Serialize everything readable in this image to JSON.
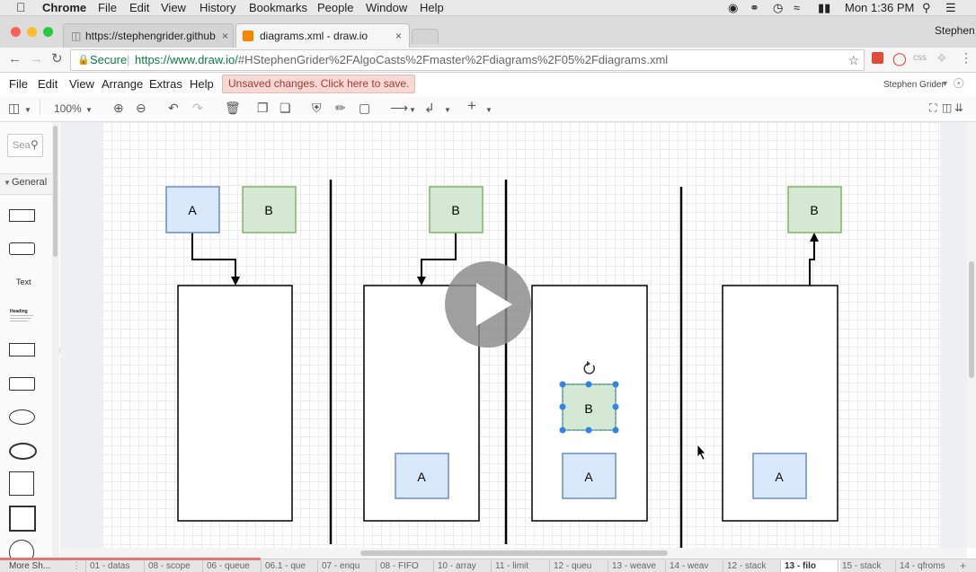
{
  "menubar": {
    "app_name": "Chrome",
    "items": [
      "File",
      "Edit",
      "View",
      "History",
      "Bookmarks",
      "People",
      "Window",
      "Help"
    ],
    "clock": "Mon 1:36 PM"
  },
  "browser": {
    "profile": "Stephen",
    "tabs": [
      {
        "title": "https://stephengrider.github.io"
      },
      {
        "title": "diagrams.xml - draw.io"
      }
    ],
    "secure_label": "Secure",
    "url_host": "https://www.draw.io/",
    "url_rest": "#HStephenGrider%2FAlgoCasts%2Fmaster%2Fdiagrams%2F05%2Fdiagrams.xml",
    "ext_css": "css"
  },
  "drawio": {
    "menu": [
      "File",
      "Edit",
      "View",
      "Arrange",
      "Extras",
      "Help"
    ],
    "unsaved_notice": "Unsaved changes. Click here to save.",
    "user": "Stephen Grider",
    "zoom": "100%",
    "search_placeholder": "Sea",
    "sidebar_section": "General",
    "text_shape_label": "Text",
    "heading_shape_label": "Heading"
  },
  "diagram": {
    "labels": {
      "a": "A",
      "b": "B"
    }
  },
  "bottom": {
    "more_shapes": "More Sh...",
    "pages": [
      "01 - datas",
      "08 - scope",
      "06 - queue",
      "06.1 - que",
      "07 - enqu",
      "08 - FIFO",
      "10 - array",
      "11 - limit",
      "12 - queu",
      "13 - weave",
      "14 - weav",
      "12 - stack",
      "13 - filo",
      "15 - stack",
      "14 - qfroms"
    ],
    "selected_page": "13 - filo"
  },
  "colors": {
    "box_a_fill": "#dae8fc",
    "box_a_stroke": "#6c8ebf",
    "box_b_fill": "#d5e8d4",
    "box_b_stroke": "#82b366",
    "selection": "#2f84e7"
  }
}
